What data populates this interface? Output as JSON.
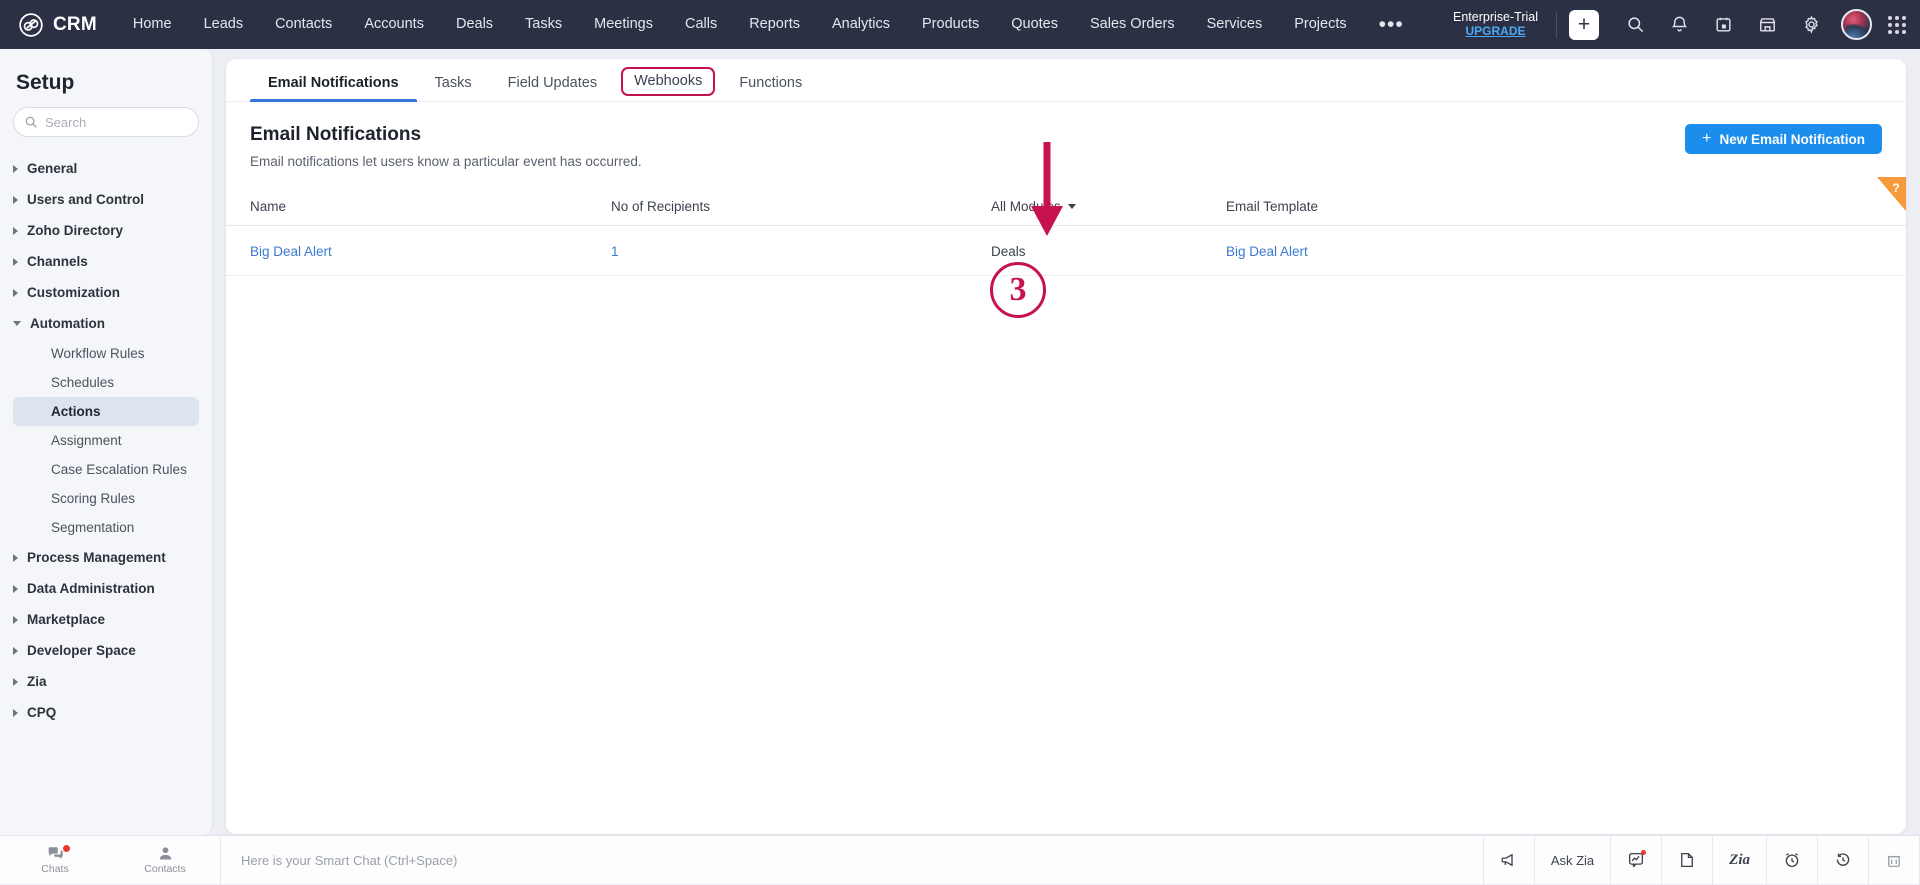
{
  "topnav": {
    "brand": "CRM",
    "items": [
      "Home",
      "Leads",
      "Contacts",
      "Accounts",
      "Deals",
      "Tasks",
      "Meetings",
      "Calls",
      "Reports",
      "Analytics",
      "Products",
      "Quotes",
      "Sales Orders",
      "Services",
      "Projects"
    ],
    "more": "•••",
    "trial_label": "Enterprise-Trial",
    "upgrade_label": "UPGRADE",
    "plus_label": "+",
    "icons": [
      "search-icon",
      "bell-icon",
      "calendar-icon",
      "store-icon",
      "gear-icon",
      "avatar",
      "grid-menu-icon"
    ]
  },
  "sidebar": {
    "title": "Setup",
    "search_placeholder": "Search",
    "search_value": "",
    "groups": [
      {
        "label": "General",
        "expanded": false
      },
      {
        "label": "Users and Control",
        "expanded": false
      },
      {
        "label": "Zoho Directory",
        "expanded": false
      },
      {
        "label": "Channels",
        "expanded": false
      },
      {
        "label": "Customization",
        "expanded": false
      },
      {
        "label": "Automation",
        "expanded": true
      }
    ],
    "automation_items": [
      {
        "label": "Workflow Rules",
        "active": false
      },
      {
        "label": "Schedules",
        "active": false
      },
      {
        "label": "Actions",
        "active": true
      },
      {
        "label": "Assignment",
        "active": false
      },
      {
        "label": "Case Escalation Rules",
        "active": false
      },
      {
        "label": "Scoring Rules",
        "active": false
      },
      {
        "label": "Segmentation",
        "active": false
      }
    ],
    "groups_after": [
      {
        "label": "Process Management"
      },
      {
        "label": "Data Administration"
      },
      {
        "label": "Marketplace"
      },
      {
        "label": "Developer Space"
      },
      {
        "label": "Zia"
      },
      {
        "label": "CPQ"
      }
    ]
  },
  "main": {
    "tabs": [
      {
        "label": "Email Notifications",
        "active": true,
        "highlighted": false
      },
      {
        "label": "Tasks",
        "active": false,
        "highlighted": false
      },
      {
        "label": "Field Updates",
        "active": false,
        "highlighted": false
      },
      {
        "label": "Webhooks",
        "active": false,
        "highlighted": true
      },
      {
        "label": "Functions",
        "active": false,
        "highlighted": false
      }
    ],
    "page_title": "Email Notifications",
    "page_subtitle": "Email notifications let users know a particular event has occurred.",
    "new_button_label": "New Email Notification",
    "new_button_plus": "+",
    "table": {
      "columns": [
        {
          "label": "Name",
          "dropdown": false
        },
        {
          "label": "No of Recipients",
          "dropdown": false
        },
        {
          "label": "All Modules",
          "dropdown": true
        },
        {
          "label": "Email Template",
          "dropdown": false
        }
      ],
      "rows": [
        {
          "name": "Big Deal Alert",
          "recipients": "1",
          "module": "Deals",
          "template": "Big Deal Alert"
        }
      ]
    },
    "help_tab_label": "?"
  },
  "annotations": {
    "step_number": "3",
    "accent_color": "#c6124f"
  },
  "statusbar": {
    "tiles": [
      {
        "label": "Chats",
        "icon": "chat-bubbles-icon",
        "badge": true
      },
      {
        "label": "Contacts",
        "icon": "person-icon",
        "badge": false
      }
    ],
    "chat_placeholder": "Here is your Smart Chat (Ctrl+Space)",
    "right_buttons": [
      {
        "label": "",
        "icon": "megaphone-icon"
      },
      {
        "label": "Ask Zia",
        "icon": ""
      },
      {
        "label": "",
        "icon": "chart-bubble-icon"
      },
      {
        "label": "",
        "icon": "note-icon"
      },
      {
        "label": "Zia",
        "icon": "zia-logo-icon"
      },
      {
        "label": "",
        "icon": "alarm-clock-icon"
      },
      {
        "label": "",
        "icon": "history-icon"
      },
      {
        "label": "",
        "icon": "trash-icon"
      }
    ]
  },
  "colors": {
    "topnav_bg": "#2b3044",
    "primary_button": "#1b8ded",
    "link": "#3a7ad1",
    "annotation": "#c6124f",
    "help_tab": "#f79a3c"
  }
}
